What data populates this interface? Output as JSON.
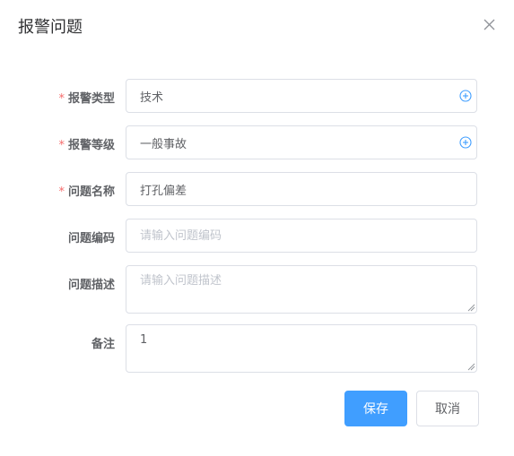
{
  "dialog": {
    "title": "报警问题",
    "close_icon": "close-icon"
  },
  "form": {
    "fields": [
      {
        "label": "报警类型",
        "required": true,
        "value": "技术",
        "placeholder": "",
        "icon": "plus-circle-icon"
      },
      {
        "label": "报警等级",
        "required": true,
        "value": "一般事故",
        "placeholder": "",
        "icon": "plus-circle-icon"
      },
      {
        "label": "问题名称",
        "required": true,
        "value": "打孔偏差",
        "placeholder": ""
      },
      {
        "label": "问题编码",
        "required": false,
        "value": "",
        "placeholder": "请输入问题编码"
      },
      {
        "label": "问题描述",
        "required": false,
        "value": "",
        "placeholder": "请输入问题描述"
      },
      {
        "label": "备注",
        "required": false,
        "value": "1",
        "placeholder": ""
      }
    ],
    "required_mark": "*"
  },
  "buttons": {
    "save_label": "保存",
    "cancel_label": "取消"
  },
  "colors": {
    "primary": "#409eff",
    "required": "#f56c6c",
    "icon": "#409eff"
  }
}
